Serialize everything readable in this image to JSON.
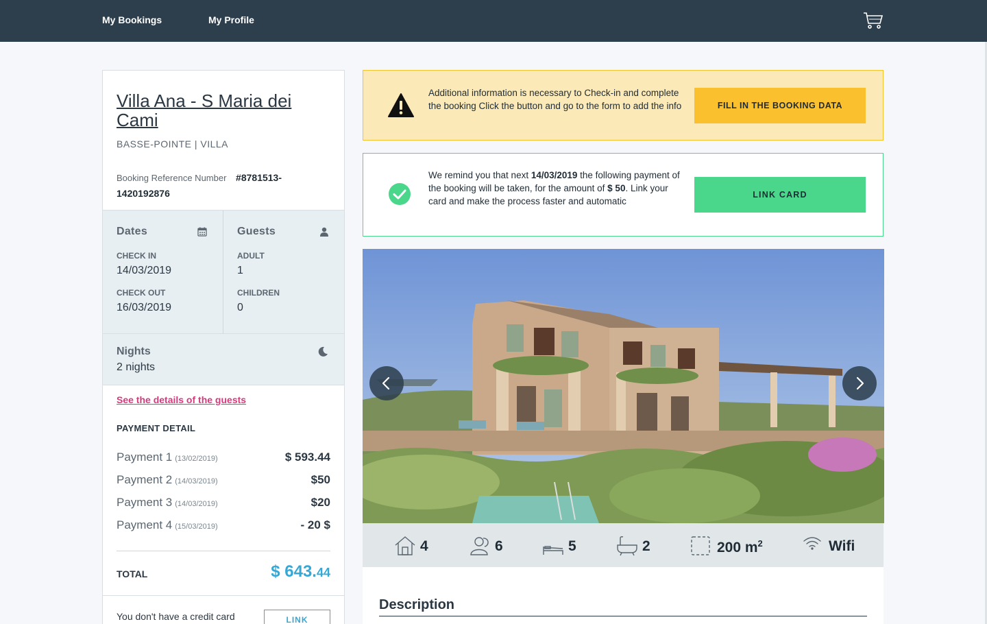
{
  "nav": {
    "bookings_label": "My Bookings",
    "profile_label": "My Profile",
    "cart_icon": "cart-icon"
  },
  "property": {
    "title": "Villa Ana - S Maria dei Cami",
    "subtitle": "BASSE-POINTE | VILLA",
    "ref_label": "Booking Reference Number",
    "ref_value": "#8781513-1420192876"
  },
  "dates": {
    "heading": "Dates",
    "icon": "calendar-icon",
    "checkin_label": "CHECK IN",
    "checkin_value": "14/03/2019",
    "checkout_label": "CHECK OUT",
    "checkout_value": "16/03/2019"
  },
  "guests": {
    "heading": "Guests",
    "icon": "person-icon",
    "adult_label": "ADULT",
    "adult_value": "1",
    "children_label": "CHILDREN",
    "children_value": "0"
  },
  "nights": {
    "heading": "Nights",
    "icon": "moon-icon",
    "value": "2 nights"
  },
  "guest_details_link": "See the details of the guests",
  "payment": {
    "heading": "PAYMENT DETAIL",
    "rows": [
      {
        "label": "Payment 1",
        "date": "(13/02/2019)",
        "amount": "$ 593.44"
      },
      {
        "label": "Payment 2",
        "date": "(14/03/2019)",
        "amount": "$50"
      },
      {
        "label": "Payment 3",
        "date": "(14/03/2019)",
        "amount": "$20"
      },
      {
        "label": "Payment 4",
        "date": "(15/03/2019)",
        "amount": "- 20 $"
      }
    ],
    "total_label": "TOTAL",
    "total_main": "$ 643.",
    "total_cents": "44"
  },
  "credit": {
    "text": "You don't have a credit card",
    "button": "LINK"
  },
  "alerts": {
    "warning": {
      "icon": "warning-icon",
      "text": "Additional information is necessary to Check-in and complete the booking Click the button and go to the form to add the info",
      "button": "FILL IN THE BOOKING DATA"
    },
    "reminder": {
      "icon": "check-circle-icon",
      "text_1": "We remind you that next ",
      "date": "14/03/2019",
      "text_2": " the following payment of the booking will be taken, for the amount of ",
      "amount": "$ 50",
      "text_3": ". Link your card and make the process faster and automatic",
      "button": "LINK CARD"
    }
  },
  "amenities": [
    {
      "icon": "house-icon",
      "value": "4"
    },
    {
      "icon": "guests-icon",
      "value": "6"
    },
    {
      "icon": "bed-icon",
      "value": "5"
    },
    {
      "icon": "bathtub-icon",
      "value": "2"
    },
    {
      "icon": "area-icon",
      "value": "200 m",
      "sup": "2"
    },
    {
      "icon": "wifi-icon",
      "value": "Wifi"
    }
  ],
  "description": {
    "title": "Description"
  },
  "colors": {
    "nav_bg": "#2d3e4c",
    "warning_bg": "#fbe9b7",
    "warning_btn": "#fbc02d",
    "success": "#4ad78b",
    "accent_pink": "#d63a7c",
    "accent_blue": "#35a8d6"
  }
}
